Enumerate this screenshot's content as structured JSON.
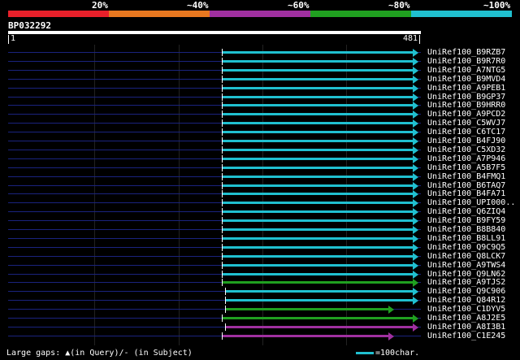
{
  "legend": {
    "colors": [
      "#e8202a",
      "#e87820",
      "#a030a0",
      "#20a020",
      "#20c0d0"
    ],
    "labels": [
      "20%",
      "~40%",
      "~60%",
      "~80%",
      "~100%"
    ]
  },
  "query": {
    "id": "BP032292",
    "start": "1",
    "end": "481"
  },
  "hits": [
    {
      "name": "UniRef100_B9RZB7",
      "color": "#20c0d0",
      "start_frac": 0.517,
      "end_frac": 0.995
    },
    {
      "name": "UniRef100_B9R7R0",
      "color": "#20c0d0",
      "start_frac": 0.517,
      "end_frac": 0.995
    },
    {
      "name": "UniRef100_A7NTG5",
      "color": "#20c0d0",
      "start_frac": 0.517,
      "end_frac": 0.995
    },
    {
      "name": "UniRef100_B9MVD4",
      "color": "#20c0d0",
      "start_frac": 0.517,
      "end_frac": 0.995
    },
    {
      "name": "UniRef100_A9PEB1",
      "color": "#20c0d0",
      "start_frac": 0.517,
      "end_frac": 0.995
    },
    {
      "name": "UniRef100_B9GP37",
      "color": "#20c0d0",
      "start_frac": 0.517,
      "end_frac": 0.995
    },
    {
      "name": "UniRef100_B9HRR0",
      "color": "#20c0d0",
      "start_frac": 0.517,
      "end_frac": 0.995
    },
    {
      "name": "UniRef100_A9PCD2",
      "color": "#20c0d0",
      "start_frac": 0.517,
      "end_frac": 0.995
    },
    {
      "name": "UniRef100_C5WVJ7",
      "color": "#20c0d0",
      "start_frac": 0.517,
      "end_frac": 0.995
    },
    {
      "name": "UniRef100_C6TC17",
      "color": "#20c0d0",
      "start_frac": 0.517,
      "end_frac": 0.995
    },
    {
      "name": "UniRef100_B4FJ90",
      "color": "#20c0d0",
      "start_frac": 0.517,
      "end_frac": 0.995
    },
    {
      "name": "UniRef100_C5XD32",
      "color": "#20c0d0",
      "start_frac": 0.517,
      "end_frac": 0.995
    },
    {
      "name": "UniRef100_A7P946",
      "color": "#20c0d0",
      "start_frac": 0.517,
      "end_frac": 0.995
    },
    {
      "name": "UniRef100_A5B7F5",
      "color": "#20c0d0",
      "start_frac": 0.517,
      "end_frac": 0.995
    },
    {
      "name": "UniRef100_B4FMQ1",
      "color": "#20c0d0",
      "start_frac": 0.517,
      "end_frac": 0.995
    },
    {
      "name": "UniRef100_B6TAQ7",
      "color": "#20c0d0",
      "start_frac": 0.517,
      "end_frac": 0.995
    },
    {
      "name": "UniRef100_B4FA71",
      "color": "#20c0d0",
      "start_frac": 0.517,
      "end_frac": 0.995
    },
    {
      "name": "UniRef100_UPI000..",
      "color": "#20c0d0",
      "start_frac": 0.517,
      "end_frac": 0.995
    },
    {
      "name": "UniRef100_Q6ZIQ4",
      "color": "#20c0d0",
      "start_frac": 0.517,
      "end_frac": 0.995
    },
    {
      "name": "UniRef100_B9FY59",
      "color": "#20c0d0",
      "start_frac": 0.517,
      "end_frac": 0.995
    },
    {
      "name": "UniRef100_B8B840",
      "color": "#20c0d0",
      "start_frac": 0.517,
      "end_frac": 0.995
    },
    {
      "name": "UniRef100_B8LL91",
      "color": "#20c0d0",
      "start_frac": 0.517,
      "end_frac": 0.995
    },
    {
      "name": "UniRef100_Q9C9Q5",
      "color": "#20c0d0",
      "start_frac": 0.517,
      "end_frac": 0.995
    },
    {
      "name": "UniRef100_Q8LCK7",
      "color": "#20c0d0",
      "start_frac": 0.517,
      "end_frac": 0.995
    },
    {
      "name": "UniRef100_A9TWS4",
      "color": "#20c0d0",
      "start_frac": 0.517,
      "end_frac": 0.995
    },
    {
      "name": "UniRef100_Q9LN62",
      "color": "#20c0d0",
      "start_frac": 0.517,
      "end_frac": 0.995
    },
    {
      "name": "UniRef100_A9TJS2",
      "color": "#20a020",
      "start_frac": 0.517,
      "end_frac": 0.995
    },
    {
      "name": "UniRef100_Q9C906",
      "color": "#20c0d0",
      "start_frac": 0.525,
      "end_frac": 0.995
    },
    {
      "name": "UniRef100_Q84R12",
      "color": "#20c0d0",
      "start_frac": 0.525,
      "end_frac": 0.995
    },
    {
      "name": "UniRef100_C1DYV5",
      "color": "#20a020",
      "start_frac": 0.525,
      "end_frac": 0.935
    },
    {
      "name": "UniRef100_A8J2E5",
      "color": "#20a020",
      "start_frac": 0.517,
      "end_frac": 0.995
    },
    {
      "name": "UniRef100_A8I3B1",
      "color": "#a030a0",
      "start_frac": 0.525,
      "end_frac": 0.995
    },
    {
      "name": "UniRef100_C1E245",
      "color": "#a030a0",
      "start_frac": 0.517,
      "end_frac": 0.935
    }
  ],
  "footer": {
    "gaps_label": "Large gaps: ▲(in Query)/- (in Subject)",
    "scale_label": "=100char."
  }
}
